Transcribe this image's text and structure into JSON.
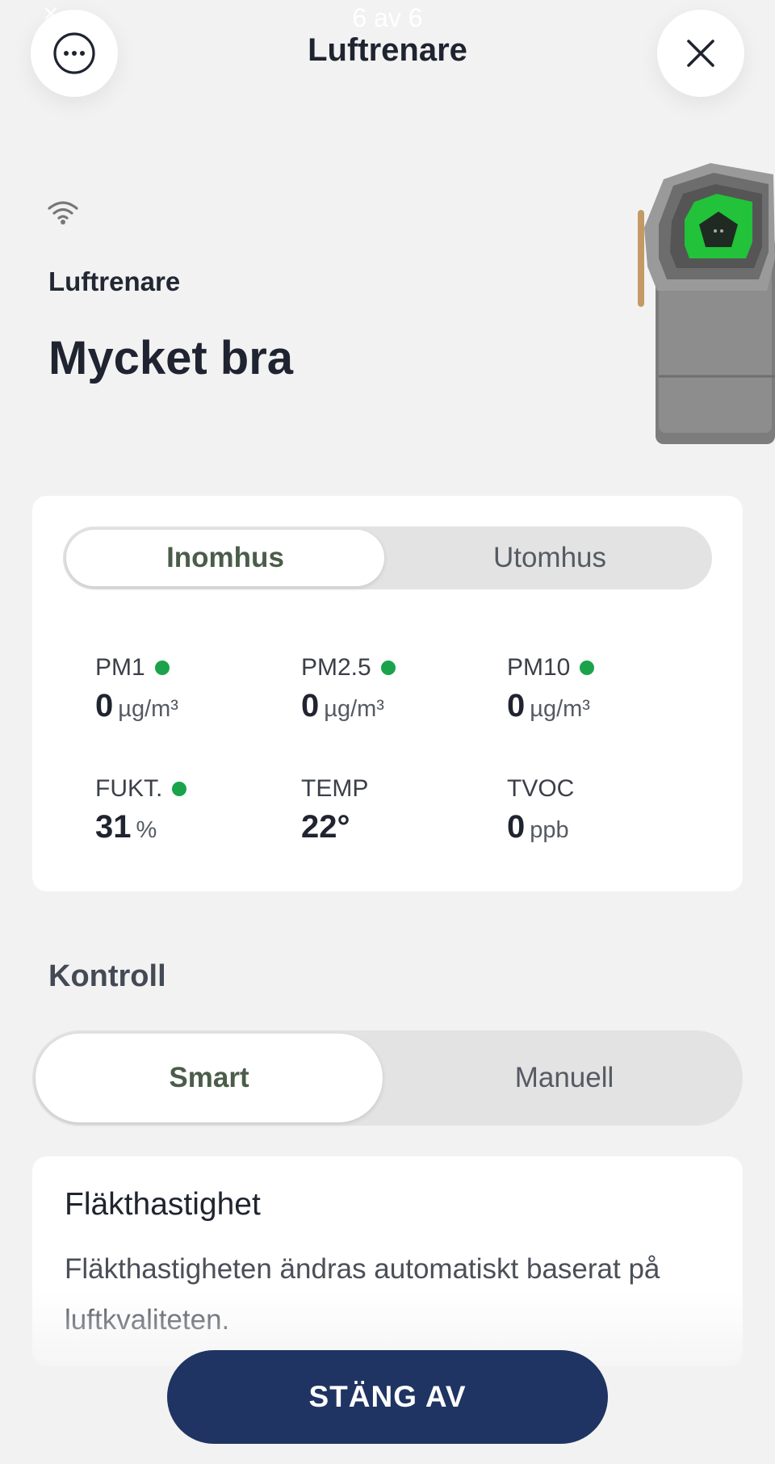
{
  "overlay": {
    "counter": "6 av 6"
  },
  "header": {
    "title": "Luftrenare",
    "menu_icon": "more-horizontal-circle-icon",
    "close_icon": "close-icon"
  },
  "device": {
    "connection_icon": "wifi-icon",
    "label": "Luftrenare",
    "status": "Mycket bra"
  },
  "air_quality": {
    "tabs": [
      {
        "label": "Inomhus",
        "selected": true
      },
      {
        "label": "Utomhus",
        "selected": false
      }
    ],
    "metrics": [
      {
        "label": "PM1",
        "value": "0",
        "unit": "µg/m³",
        "indicator": true
      },
      {
        "label": "PM2.5",
        "value": "0",
        "unit": "µg/m³",
        "indicator": true
      },
      {
        "label": "PM10",
        "value": "0",
        "unit": "µg/m³",
        "indicator": true
      },
      {
        "label": "FUKT.",
        "value": "31",
        "unit": "%",
        "indicator": true
      },
      {
        "label": "TEMP",
        "value": "22°",
        "unit": "",
        "indicator": false
      },
      {
        "label": "TVOC",
        "value": "0",
        "unit": "ppb",
        "indicator": false
      }
    ],
    "indicator_color": "#1aa34a"
  },
  "control": {
    "title": "Kontroll",
    "modes": [
      {
        "label": "Smart",
        "selected": true
      },
      {
        "label": "Manuell",
        "selected": false
      }
    ]
  },
  "fan": {
    "title": "Fläkthastighet",
    "description": "Fläkthastigheten ändras automatiskt baserat på luftkvaliteten."
  },
  "footer": {
    "off_button": "STÄNG AV",
    "button_color": "#1f3462"
  }
}
